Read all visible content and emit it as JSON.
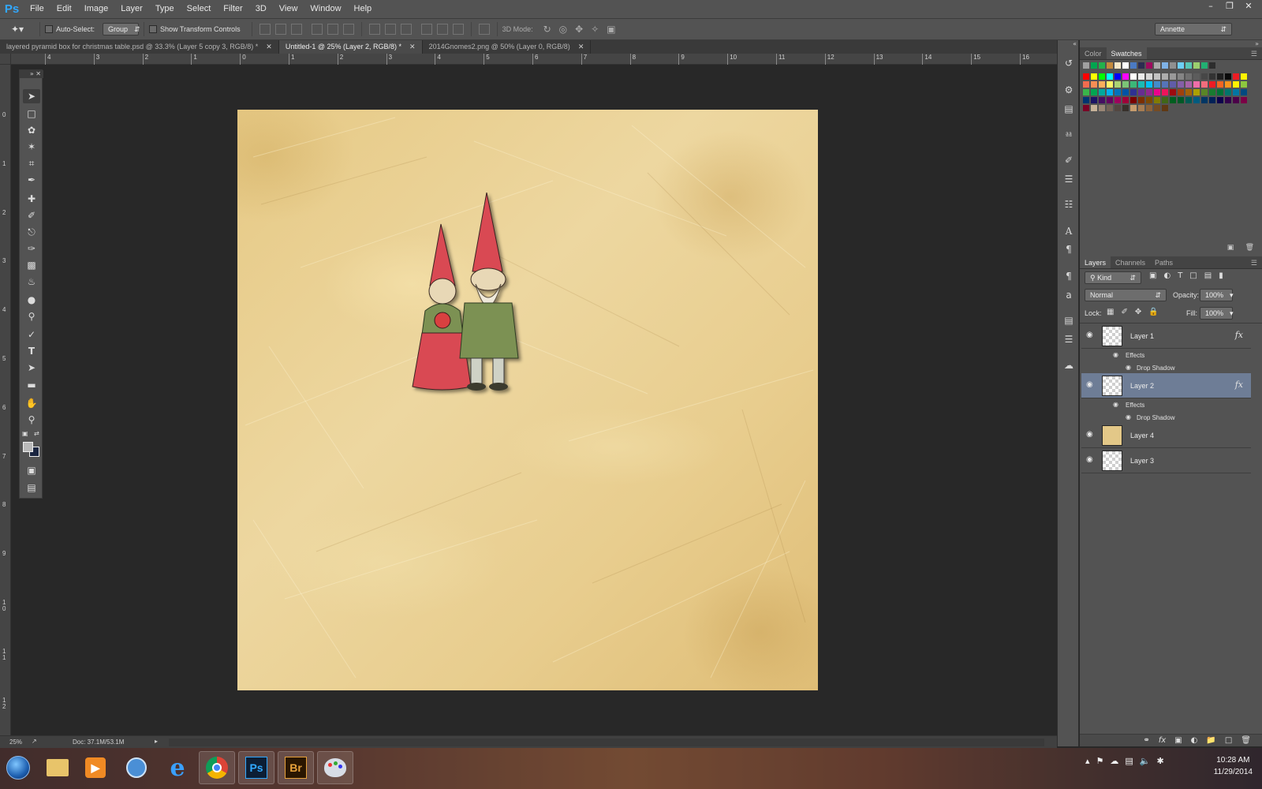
{
  "app": {
    "logo": "Ps",
    "menus": [
      "File",
      "Edit",
      "Image",
      "Layer",
      "Type",
      "Select",
      "Filter",
      "3D",
      "View",
      "Window",
      "Help"
    ],
    "workspace": "Annette"
  },
  "options_bar": {
    "auto_select_label": "Auto-Select:",
    "auto_select_value": "Group",
    "show_transform_label": "Show Transform Controls",
    "mode_label": "3D Mode:"
  },
  "tabs": [
    {
      "label": "layered pyramid box for christmas table.psd @ 33.3% (Layer 5 copy 3, RGB/8) *",
      "active": false
    },
    {
      "label": "Untitled-1 @ 25% (Layer 2, RGB/8) *",
      "active": true
    },
    {
      "label": "2014Gnomes2.png @ 50% (Layer 0, RGB/8)",
      "active": false
    }
  ],
  "ruler": {
    "top_ticks": [
      "4",
      "3",
      "2",
      "1",
      "0",
      "1",
      "2",
      "3",
      "4",
      "5",
      "6",
      "7",
      "8",
      "9",
      "10",
      "11",
      "12",
      "13",
      "14",
      "15",
      "16"
    ],
    "left_ticks": [
      "0",
      "1",
      "2",
      "3",
      "4",
      "5",
      "6",
      "7",
      "8",
      "9",
      "1\n0",
      "1\n1",
      "1\n2"
    ]
  },
  "tools": [
    "move-tool",
    "marquee-tool",
    "lasso-tool",
    "magic-wand-tool",
    "crop-tool",
    "eyedropper-tool",
    "healing-brush-tool",
    "brush-tool",
    "clone-stamp-tool",
    "history-brush-tool",
    "eraser-tool",
    "paint-bucket-tool",
    "blur-tool",
    "dodge-tool",
    "pen-tool",
    "type-tool",
    "path-selection-tool",
    "rectangle-tool",
    "hand-tool",
    "zoom-tool"
  ],
  "color_panel": {
    "tabs": [
      "Color",
      "Swatches"
    ],
    "active_tab": "Swatches",
    "swatches": [
      [
        "#a0a0a0",
        "#00a54f",
        "#22b24c",
        "#c48a3c",
        "#f7e8c9",
        "#ffffff",
        "#4b7ac3",
        "#2c2c50",
        "#9e0b5e",
        "#aaaaaa",
        "#7fb2e6",
        "#909090",
        "#6dcff6",
        "#58c7b7",
        "#9ccf6e",
        "#22b073",
        "#2d2d2d"
      ],
      [
        "#ff0000",
        "#ffff00",
        "#00ff00",
        "#00ffff",
        "#0000ff",
        "#ff00ff",
        "#ffffff",
        "#ebebeb",
        "#d6d6d6",
        "#c2c2c2",
        "#adadad",
        "#999999",
        "#858585",
        "#707070",
        "#5c5c5c",
        "#474747",
        "#333333",
        "#1f1f1f",
        "#0a0a0a",
        "#ed1c24",
        "#fff200"
      ],
      [
        "#f26c4f",
        "#f68e55",
        "#fbaf5c",
        "#fff467",
        "#acd372",
        "#7cc576",
        "#3bb878",
        "#1abbb4",
        "#00bff3",
        "#438ccb",
        "#5574b9",
        "#605ca8",
        "#855fa8",
        "#a763a8",
        "#f06ea9",
        "#f26d7d",
        "#ed1c24",
        "#f26522",
        "#f7941d",
        "#fff200",
        "#8dc73f"
      ],
      [
        "#39b54a",
        "#00a651",
        "#00a99d",
        "#00aeef",
        "#0072bc",
        "#0054a6",
        "#2e3192",
        "#662d91",
        "#92278f",
        "#ec008c",
        "#ed145b",
        "#9e0b0f",
        "#a0410d",
        "#a36209",
        "#aba000",
        "#598527",
        "#197b30",
        "#007236",
        "#00746b",
        "#0076a3",
        "#004a80"
      ],
      [
        "#003471",
        "#1b1464",
        "#440e62",
        "#630460",
        "#9e005d",
        "#9e0039",
        "#790000",
        "#7b2e00",
        "#7d4900",
        "#827b00",
        "#406618",
        "#005e20",
        "#005826",
        "#005952",
        "#005b7f",
        "#003663",
        "#002157",
        "#0d004c",
        "#32004b",
        "#4b0049",
        "#7b0046"
      ],
      [
        "#7a0026",
        "#c7b299",
        "#998675",
        "#736357",
        "#534741",
        "#37302a",
        "#c69c6d",
        "#a67c52",
        "#8c6239",
        "#754c24",
        "#603913"
      ]
    ]
  },
  "layers_panel": {
    "tabs": [
      "Layers",
      "Channels",
      "Paths"
    ],
    "active_tab": "Layers",
    "filter_kind": "Kind",
    "blend_mode": "Normal",
    "opacity_label": "Opacity:",
    "opacity_value": "100%",
    "lock_label": "Lock:",
    "fill_label": "Fill:",
    "fill_value": "100%",
    "effects_label": "Effects",
    "drop_shadow_label": "Drop Shadow",
    "layers": [
      {
        "name": "Layer 1",
        "fx": "fx",
        "selected": false
      },
      {
        "name": "Layer 2",
        "fx": "fx",
        "selected": true
      },
      {
        "name": "Layer 4",
        "fx": "",
        "selected": false
      },
      {
        "name": "Layer 3",
        "fx": "",
        "selected": false
      }
    ]
  },
  "status": {
    "zoom": "25%",
    "doc": "Doc: 37.1M/53.1M"
  },
  "taskbar": {
    "apps": [
      "start-button",
      "file-explorer",
      "media-player",
      "network-app",
      "internet-explorer",
      "chrome",
      "photoshop",
      "bridge",
      "paint-app"
    ],
    "ps_label": "Ps",
    "br_label": "Br",
    "time": "10:28 AM",
    "date": "11/29/2014"
  }
}
